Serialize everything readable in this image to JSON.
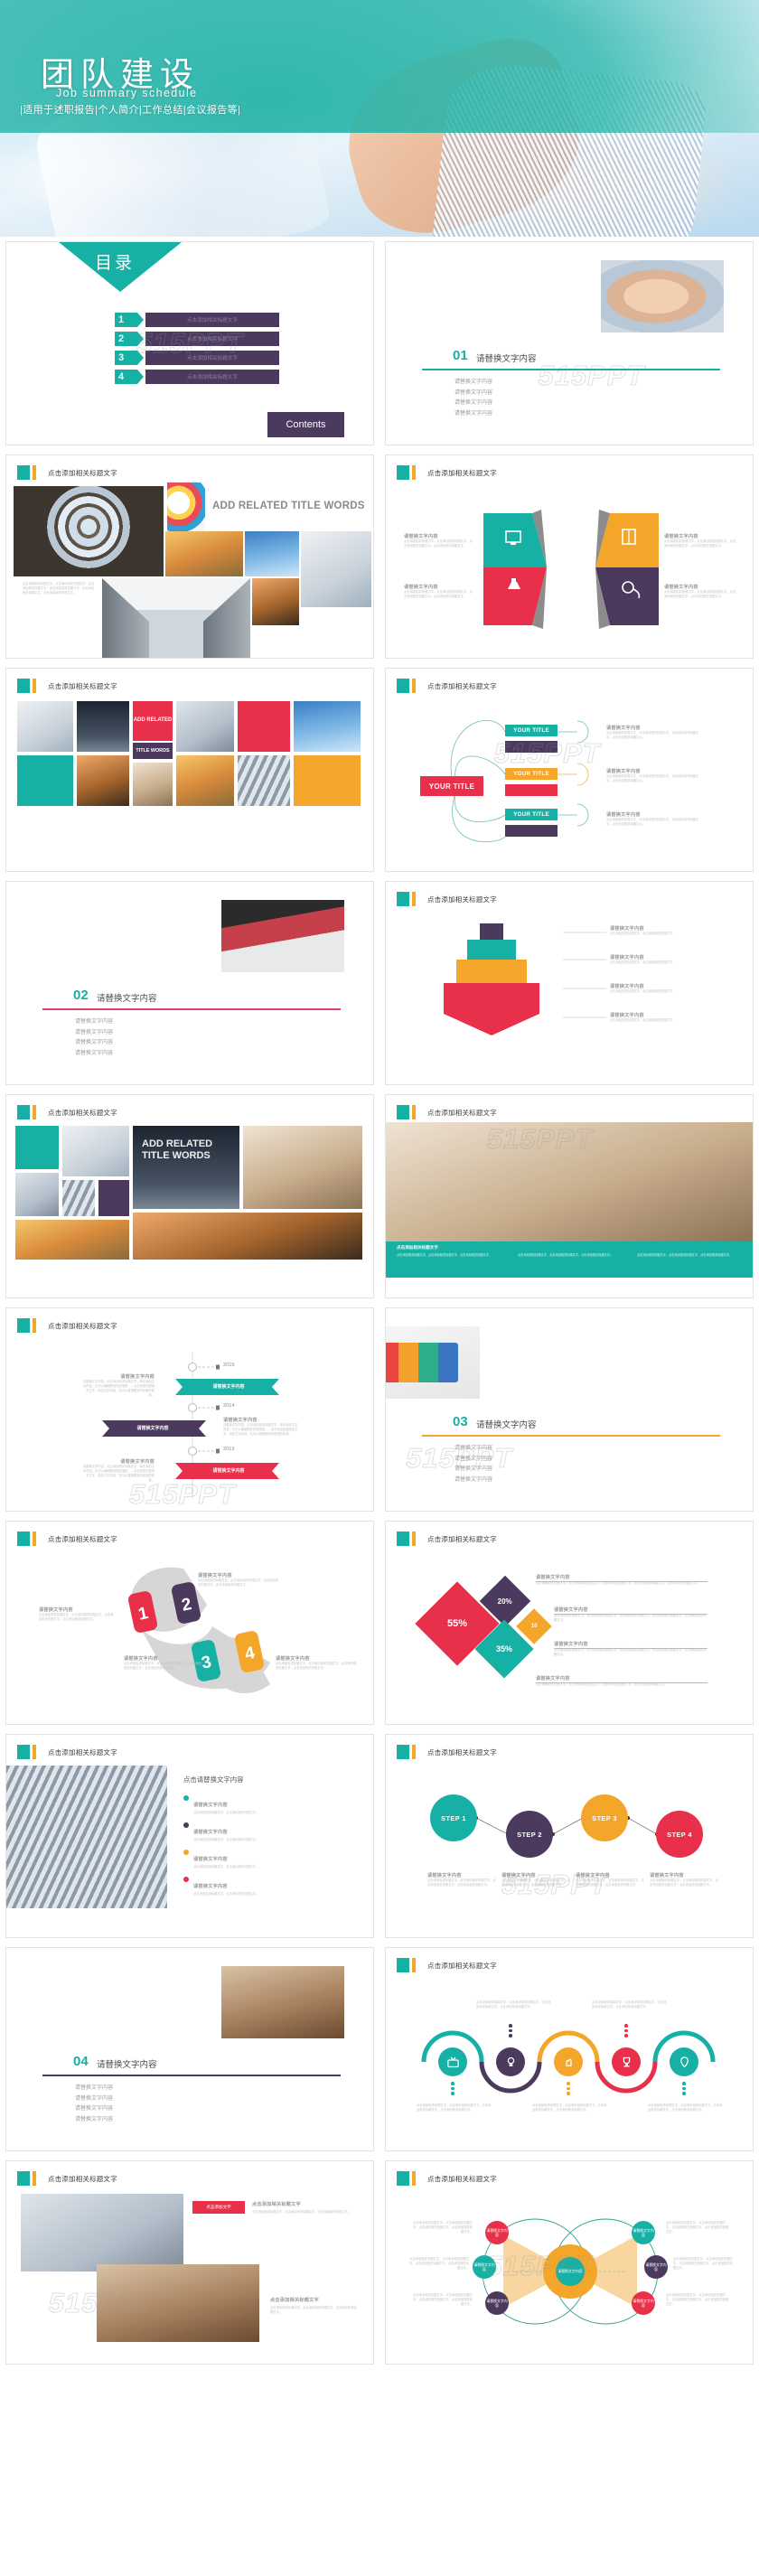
{
  "cover": {
    "title": "团队建设",
    "subtitle": "Job summary schedule",
    "tagline": "|适用于述职报告|个人简介|工作总结|会议报告等|"
  },
  "watermark": "515PPT",
  "common": {
    "slide_header_title": "点击添加相关标题文字",
    "body_title": "请替换文字内容",
    "body_text": "点击添加相关标题文字，点击添加相关标题文字，点击添加相关标题文字，点击添加相关标题文字。",
    "body_text_short": "点击添加相关标题文字，点击添加相关标题文字。",
    "toc_item_label": "点击添加相关标题文字",
    "your_title": "YOUR TITLE",
    "add_related_title": "ADD RELATED  TITLE WORDS",
    "click_replace": "点击请替换文字内容"
  },
  "colors": {
    "teal": "#17b0a4",
    "purple": "#4b3a5e",
    "red": "#e8304a",
    "orange": "#f4a62a",
    "crimson": "#d94368",
    "gray": "#bfbfbf"
  },
  "slides": [
    {
      "id": "toc",
      "kind": "toc",
      "heading": "目录",
      "contents_label": "Contents",
      "items": [
        {
          "num": "1",
          "label": "点击添加相关标题文字"
        },
        {
          "num": "2",
          "label": "点击添加相关标题文字"
        },
        {
          "num": "3",
          "label": "点击添加相关标题文字"
        },
        {
          "num": "4",
          "label": "点击添加相关标题文字"
        }
      ]
    },
    {
      "id": "section-01",
      "kind": "section",
      "number": "01",
      "title": "请替换文字内容",
      "rule_color": "#17b0a4",
      "image": "handshake",
      "lines": [
        "请替换文字内容",
        "请替换文字内容",
        "请替换文字内容",
        "请替换文字内容"
      ]
    },
    {
      "id": "gallery-1",
      "kind": "gallery1",
      "header": "点击添加相关标题文字",
      "big_title": "ADD RELATED  TITLE WORDS",
      "caption": "点击添加相关标题文字，点击添加相关标题文字，点击添加相关标题文字，点击添加相关标题文字，点击添加相关标题文字，点击添加相关标题文字。"
    },
    {
      "id": "hex-ribbon",
      "kind": "hexribbon",
      "header": "点击添加相关标题文字",
      "items": [
        {
          "title": "请替换文字内容",
          "body": "点击添加相关标题文字，点击添加相关标题文字，点击添加相关标题文字，点击添加相关标题文字。",
          "color": "#17b0a4",
          "icon": "monitor-icon"
        },
        {
          "title": "请替换文字内容",
          "body": "点击添加相关标题文字，点击添加相关标题文字，点击添加相关标题文字，点击添加相关标题文字。",
          "color": "#f4a62a",
          "icon": "book-icon"
        },
        {
          "title": "请替换文字内容",
          "body": "点击添加相关标题文字，点击添加相关标题文字，点击添加相关标题文字，点击添加相关标题文字。",
          "color": "#e8304a",
          "icon": "flask-icon"
        },
        {
          "title": "请替换文字内容",
          "body": "点击添加相关标题文字，点击添加相关标题文字，点击添加相关标题文字，点击添加相关标题文字。",
          "color": "#4b3a5e",
          "icon": "drip-icon"
        }
      ]
    },
    {
      "id": "gallery-2",
      "kind": "gallery2",
      "header": "点击添加相关标题文字",
      "big_title_line1": "ADD RELATED",
      "big_title_line2": "TITLE WORDS"
    },
    {
      "id": "mindmap",
      "kind": "mindmap",
      "header": "点击添加相关标题文字",
      "root_label": "YOUR TITLE",
      "branches": [
        {
          "label": "YOUR TITLE",
          "color": "#17b0a4"
        },
        {
          "label": "",
          "color": "#4b3a5e"
        },
        {
          "label": "YOUR TITLE",
          "color": "#f4a62a"
        },
        {
          "label": "",
          "color": "#e8304a"
        },
        {
          "label": "YOUR TITLE",
          "color": "#17b0a4"
        },
        {
          "label": "",
          "color": "#4b3a5e"
        }
      ],
      "notes": [
        {
          "title": "请替换文字内容",
          "body": "点击添加相关标题文字，点击添加相关标题文字，点击添加相关标题文字，点击添加相关标题文字。"
        },
        {
          "title": "请替换文字内容",
          "body": "点击添加相关标题文字，点击添加相关标题文字，点击添加相关标题文字，点击添加相关标题文字。"
        },
        {
          "title": "请替换文字内容",
          "body": "点击添加相关标题文字，点击添加相关标题文字，点击添加相关标题文字，点击添加相关标题文字。"
        }
      ]
    },
    {
      "id": "section-02",
      "kind": "section",
      "number": "02",
      "title": "请替换文字内容",
      "rule_color": "#d94368",
      "image": "raft",
      "lines": [
        "请替换文字内容",
        "请替换文字内容",
        "请替换文字内容",
        "请替换文字内容"
      ]
    },
    {
      "id": "stack-steps",
      "kind": "stack",
      "header": "点击添加相关标题文字",
      "items": [
        {
          "color": "#4b3a5e",
          "title": "请替换文字内容",
          "body": "点击添加相关标题文字，点击添加相关标题文字。"
        },
        {
          "color": "#17b0a4",
          "title": "请替换文字内容",
          "body": "点击添加相关标题文字，点击添加相关标题文字。"
        },
        {
          "color": "#f4a62a",
          "title": "请替换文字内容",
          "body": "点击添加相关标题文字，点击添加相关标题文字。"
        },
        {
          "color": "#e8304a",
          "title": "请替换文字内容",
          "body": "点击添加相关标题文字，点击添加相关标题文字。"
        }
      ]
    },
    {
      "id": "gallery-3",
      "kind": "gallery3",
      "header": "点击添加相关标题文字",
      "big_title_line1": "ADD RELATED",
      "big_title_line2": "TITLE WORDS"
    },
    {
      "id": "photo-banner",
      "kind": "photobanner",
      "header": "点击添加相关标题文字",
      "caption_title": "点击添加相关标题文字",
      "columns": [
        "点击添加相关标题文字，点击添加相关标题文字，点击添加相关标题文字。",
        "点击添加相关标题文字，点击添加相关标题文字，点击添加相关标题文字。",
        "点击添加相关标题文字，点击添加相关标题文字，点击添加相关标题文字。"
      ]
    },
    {
      "id": "timeline",
      "kind": "timeline",
      "header": "点击添加相关标题文字",
      "entries": [
        {
          "year": "2015",
          "color": "#17b0a4",
          "label": "请替换文字内容",
          "side": "right",
          "note_title": "请替换文字内容",
          "note_body": "请替换文字内容，点击添加相关标题文字，单击添加文字内容，在可以编辑删除的段落框。，点击添加标题相关文字，填充文字内容，在可以直接删除的段落的段落。"
        },
        {
          "year": "2014",
          "color": "#4b3a5e",
          "label": "请替换文字内容",
          "side": "left",
          "note_title": "请替换文字内容",
          "note_body": "请替换文字内容，点击添加相关标题文字，单击添加文字内容，在可以编辑删除的段落框。，点击添加标题相关文字，填充文字内容，在可以直接删除的段落的段落。"
        },
        {
          "year": "2013",
          "color": "#e8304a",
          "label": "请替换文字内容",
          "side": "right",
          "note_title": "请替换文字内容",
          "note_body": "请替换文字内容，点击添加相关标题文字，单击添加文字内容，在可以编辑删除的段落框。，点击添加标题相关文字，填充文字内容，在可以直接删除的段落的段落。"
        }
      ]
    },
    {
      "id": "section-03",
      "kind": "section",
      "number": "03",
      "title": "请替换文字内容",
      "rule_color": "#f4a62a",
      "image": "puzzle",
      "lines": [
        "请替换文字内容",
        "请替换文字内容",
        "请替换文字内容",
        "请替换文字内容"
      ]
    },
    {
      "id": "number-ribbon",
      "kind": "numribbon",
      "header": "点击添加相关标题文字",
      "items": [
        {
          "num": "1",
          "color": "#e8304a",
          "title": "请替换文字内容",
          "body": "点击添加相关标题文字，点击添加相关标题文字，点击添加相关标题文字，点击添加相关标题文字。"
        },
        {
          "num": "2",
          "color": "#4b3a5e",
          "title": "请替换文字内容",
          "body": "点击添加相关标题文字，点击添加相关标题文字，点击添加相关标题文字，点击添加相关标题文字。"
        },
        {
          "num": "3",
          "color": "#17b0a4",
          "title": "请替换文字内容",
          "body": "点击添加相关标题文字，点击添加相关标题文字，点击添加相关标题文字，点击添加相关标题文字。"
        },
        {
          "num": "4",
          "color": "#f4a62a",
          "title": "请替换文字内容",
          "body": "点击添加相关标题文字，点击添加相关标题文字，点击添加相关标题文字，点击添加相关标题文字。"
        }
      ]
    },
    {
      "id": "diamonds",
      "kind": "diamonds",
      "header": "点击添加相关标题文字",
      "chart_ref": 0,
      "notes": [
        {
          "title": "请替换文字内容",
          "body": "点击添加相关标题文字，点击添加相关标题文字，点击添加相关标题文字，点击添加相关标题文字，点击添加相关标题文字。"
        },
        {
          "title": "请替换文字内容",
          "body": "点击添加相关标题文字，点击添加相关标题文字，点击添加相关标题文字，点击添加相关标题文字，点击添加相关标题文字。"
        },
        {
          "title": "请替换文字内容",
          "body": "点击添加相关标题文字，点击添加相关标题文字，点击添加相关标题文字，点击添加相关标题文字，点击添加相关标题文字。"
        },
        {
          "title": "请替换文字内容",
          "body": "点击添加相关标题文字，点击添加相关标题文字，点击添加相关标题文字，点击添加相关标题文字。"
        }
      ]
    },
    {
      "id": "photo-bullets",
      "kind": "photobullets",
      "header": "点击添加相关标题文字",
      "title": "点击请替换文字内容",
      "bullets": [
        {
          "color": "#17b0a4",
          "title": "请替换文字内容",
          "body": "点击添加相关标题文字，点击添加相关标题文字。"
        },
        {
          "color": "#4b3a5e",
          "title": "请替换文字内容",
          "body": "点击添加相关标题文字，点击添加相关标题文字。"
        },
        {
          "color": "#f4a62a",
          "title": "请替换文字内容",
          "body": "点击添加相关标题文字，点击添加相关标题文字。"
        },
        {
          "color": "#e8304a",
          "title": "请替换文字内容",
          "body": "点击添加相关标题文字，点击添加相关标题文字。"
        }
      ]
    },
    {
      "id": "steps",
      "kind": "steps",
      "header": "点击添加相关标题文字",
      "items": [
        {
          "label": "STEP 1",
          "color": "#17b0a4",
          "title": "请替换文字内容",
          "body": "点击添加相关标题文字，点击添加相关标题文字，点击添加相关标题文字，点击添加相关标题文字。"
        },
        {
          "label": "STEP 2",
          "color": "#4b3a5e",
          "title": "请替换文字内容",
          "body": "点击添加相关标题文字，点击添加相关标题文字，点击添加相关标题文字，点击添加相关标题文字。"
        },
        {
          "label": "STEP 3",
          "color": "#f4a62a",
          "title": "请替换文字内容",
          "body": "点击添加相关标题文字，点击添加相关标题文字，点击添加相关标题文字，点击添加相关标题文字。"
        },
        {
          "label": "STEP 4",
          "color": "#e8304a",
          "title": "请替换文字内容",
          "body": "点击添加相关标题文字，点击添加相关标题文字，点击添加相关标题文字，点击添加相关标题文字。"
        }
      ]
    },
    {
      "id": "section-04",
      "kind": "section",
      "number": "04",
      "title": "请替换文字内容",
      "rule_color": "#4b3a5e",
      "image": "team-hands",
      "lines": [
        "请替换文字内容",
        "请替换文字内容",
        "请替换文字内容",
        "请替换文字内容"
      ]
    },
    {
      "id": "arch-icons",
      "kind": "archicons",
      "header": "点击添加相关标题文字",
      "items": [
        {
          "color": "#17b0a4",
          "icon": "tv-icon",
          "body": "点击添加相关标题文字，点击添加相关标题文字，点击添加相关标题文字，点击添加相关标题文字。"
        },
        {
          "color": "#4b3a5e",
          "icon": "bulb-icon",
          "body": "点击添加相关标题文字，点击添加相关标题文字，点击添加相关标题文字，点击添加相关标题文字。"
        },
        {
          "color": "#f4a62a",
          "icon": "gesture-icon",
          "body": "点击添加相关标题文字，点击添加相关标题文字，点击添加相关标题文字，点击添加相关标题文字。"
        },
        {
          "color": "#e8304a",
          "icon": "trophy-icon",
          "body": "点击添加相关标题文字，点击添加相关标题文字，点击添加相关标题文字，点击添加相关标题文字。"
        },
        {
          "color": "#17b0a4",
          "icon": "pin-icon",
          "body": "点击添加相关标题文字，点击添加相关标题文字，点击添加相关标题文字，点击添加相关标题文字。"
        }
      ]
    },
    {
      "id": "photo-pair",
      "kind": "photopair",
      "header": "点击添加相关标题文字",
      "badge": "点击添加文字",
      "caption_title": "点击添加相关标题文字",
      "caption_body": "点击添加相关标题文字，点击添加相关标题文字，点击添加相关标题文字。"
    },
    {
      "id": "venn",
      "kind": "venn",
      "header": "点击添加相关标题文字",
      "center_label": "请替换文字内容",
      "nodes": [
        {
          "label": "请替换文字内容",
          "color": "#e8304a"
        },
        {
          "label": "请替换文字内容",
          "color": "#17b0a4"
        },
        {
          "label": "请替换文字内容",
          "color": "#4b3a5e"
        },
        {
          "label": "请替换文字内容",
          "color": "#17b0a4"
        },
        {
          "label": "请替换文字内容",
          "color": "#4b3a5e"
        },
        {
          "label": "请替换文字内容",
          "color": "#e8304a"
        }
      ],
      "notes": [
        "点击添加相关标题文字，点击添加相关标题文字，点击添加相关标题文字，点击添加相关标题文字。",
        "点击添加相关标题文字，点击添加相关标题文字，点击添加相关标题文字，点击添加相关标题文字。",
        "点击添加相关标题文字，点击添加相关标题文字，点击添加相关标题文字，点击添加相关标题文字。",
        "点击添加相关标题文字，点击添加相关标题文字，点击添加相关标题文字，点击添加相关标题文字。",
        "点击添加相关标题文字，点击添加相关标题文字，点击添加相关标题文字，点击添加相关标题文字。",
        "点击添加相关标题文字，点击添加相关标题文字，点击添加相关标题文字，点击添加相关标题文字。"
      ]
    }
  ],
  "chart_data": [
    {
      "type": "pie",
      "title": "",
      "labels": [
        "请替换文字内容",
        "请替换文字内容",
        "请替换文字内容",
        "请替换文字内容"
      ],
      "values": [
        55,
        20,
        10,
        35
      ],
      "value_labels": [
        "55%",
        "20%",
        "10",
        "35%"
      ],
      "colors": [
        "#e8304a",
        "#4b3a5e",
        "#f4a62a",
        "#17b0a4"
      ],
      "legend": "right"
    }
  ]
}
